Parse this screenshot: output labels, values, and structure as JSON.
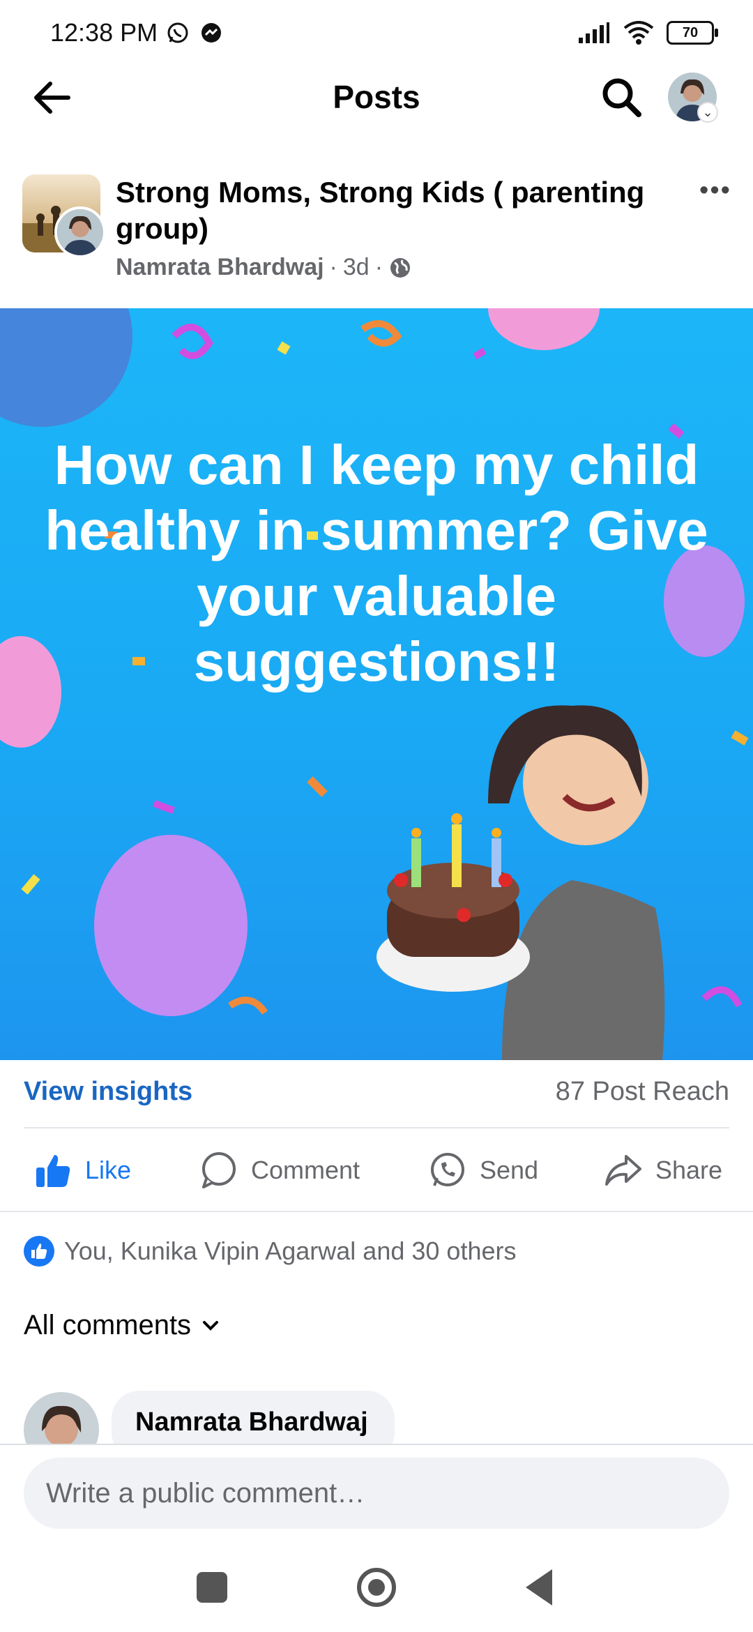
{
  "status_bar": {
    "time": "12:38 PM",
    "battery": "70",
    "icons": [
      "whatsapp-icon",
      "messenger-icon",
      "signal-icon",
      "wifi-icon",
      "battery-icon"
    ]
  },
  "top_bar": {
    "title": "Posts",
    "back_icon": "back-arrow-icon",
    "search_icon": "search-icon"
  },
  "post": {
    "group_name": "Strong Moms, Strong Kids ( parenting group)",
    "author": "Namrata Bhardwaj",
    "separator": "·",
    "age": "3d",
    "audience_icon": "globe-icon",
    "image_text": "How can I keep my child healthy in summer? Give your valuable suggestions!!",
    "insights_label": "View insights",
    "reach": "87 Post Reach",
    "actions": {
      "like": "Like",
      "comment": "Comment",
      "send": "Send",
      "share": "Share"
    },
    "reactions_text": "You, Kunika Vipin Agarwal and 30 others",
    "comments_filter": "All comments",
    "first_comment_author": "Namrata Bhardwaj"
  },
  "composer": {
    "placeholder": "Write a public comment…",
    "value": ""
  },
  "colors": {
    "brand_blue": "#1877f2",
    "link_blue": "#1a66c2",
    "secondary_text": "#65676b",
    "post_background": "#1cb6f8"
  }
}
